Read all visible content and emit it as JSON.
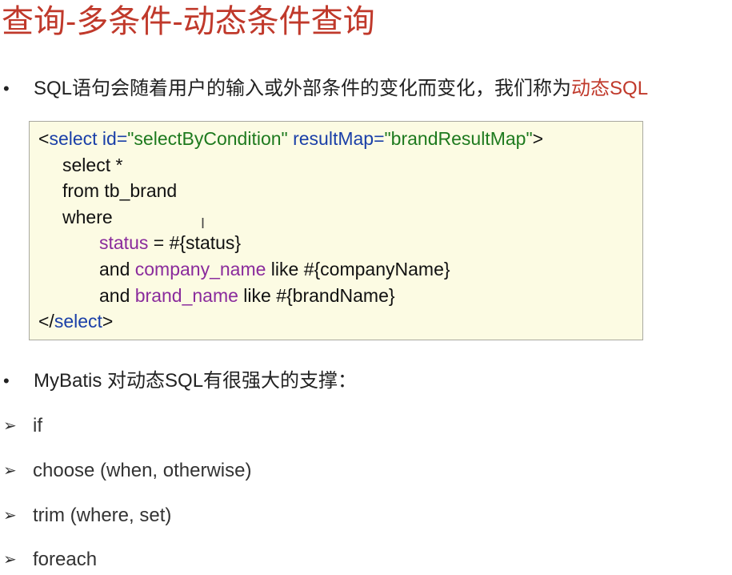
{
  "title": "查询-多条件-动态条件查询",
  "bullet1": {
    "text": "SQL语句会随着用户的输入或外部条件的变化而变化，我们称为",
    "highlight": "动态SQL"
  },
  "code": {
    "line1": {
      "open": "<",
      "tag": "select",
      "attr1": " id=",
      "val1": "\"selectByCondition\"",
      "attr2": " resultMap=",
      "val2": "\"brandResultMap\"",
      "close": ">"
    },
    "line2": "select *",
    "line3": "from tb_brand",
    "line4": "where",
    "line5": {
      "col": "status",
      "rest": " = #{status}"
    },
    "line6": {
      "pre": "and ",
      "col": "company_name",
      "rest": " like #{companyName}"
    },
    "line7": {
      "pre": "and ",
      "col": "brand_name",
      "rest": " like #{brandName}"
    },
    "line8": {
      "open": "</",
      "tag": "select",
      "close": ">"
    }
  },
  "bullet2": "MyBatis 对动态SQL有很强大的支撑：",
  "subitems": [
    "if",
    "choose (when, otherwise)",
    "trim (where, set)",
    "foreach"
  ],
  "icons": {
    "bullet": "•",
    "arrow": "➢",
    "cursor": "I"
  },
  "colors": {
    "title": "#c0392b",
    "highlight": "#c0392b",
    "code_bg": "#fcfbe3",
    "tag": "#1a3fa8",
    "string": "#1e7a1e",
    "column": "#8a2b9c"
  }
}
